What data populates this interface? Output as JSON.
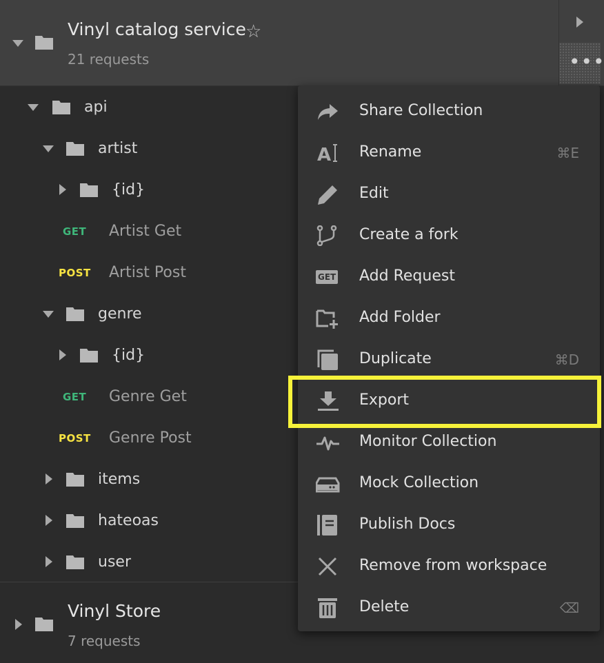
{
  "collection": {
    "name": "Vinyl catalog service",
    "count": "21 requests"
  },
  "tree": {
    "api": "api",
    "artist": "artist",
    "artist_id": "{id}",
    "artist_get": {
      "method": "GET",
      "name": "Artist Get"
    },
    "artist_post": {
      "method": "POST",
      "name": "Artist Post"
    },
    "genre": "genre",
    "genre_id": "{id}",
    "genre_get": {
      "method": "GET",
      "name": "Genre Get"
    },
    "genre_post": {
      "method": "POST",
      "name": "Genre Post"
    },
    "items": "items",
    "hateoas": "hateoas",
    "user": "user"
  },
  "collection2": {
    "name": "Vinyl Store",
    "count": "7 requests"
  },
  "menu": {
    "items": [
      {
        "label": "Share Collection",
        "shortcut": "",
        "icon": "share-icon"
      },
      {
        "label": "Rename",
        "shortcut": "⌘E",
        "icon": "rename-icon"
      },
      {
        "label": "Edit",
        "shortcut": "",
        "icon": "pencil-icon"
      },
      {
        "label": "Create a fork",
        "shortcut": "",
        "icon": "fork-icon"
      },
      {
        "label": "Add Request",
        "shortcut": "",
        "icon": "get-badge-icon"
      },
      {
        "label": "Add Folder",
        "shortcut": "",
        "icon": "add-folder-icon"
      },
      {
        "label": "Duplicate",
        "shortcut": "⌘D",
        "icon": "duplicate-icon"
      },
      {
        "label": "Export",
        "shortcut": "",
        "icon": "download-icon"
      },
      {
        "label": "Monitor Collection",
        "shortcut": "",
        "icon": "pulse-icon"
      },
      {
        "label": "Mock Collection",
        "shortcut": "",
        "icon": "server-icon"
      },
      {
        "label": "Publish Docs",
        "shortcut": "",
        "icon": "docs-icon"
      },
      {
        "label": "Remove from workspace",
        "shortcut": "",
        "icon": "close-icon"
      },
      {
        "label": "Delete",
        "shortcut": "⌫",
        "icon": "trash-icon"
      }
    ],
    "get_badge": "GET"
  },
  "colors": {
    "highlight": "#f6f23a",
    "get": "#3fb67a",
    "post": "#f7e342"
  }
}
